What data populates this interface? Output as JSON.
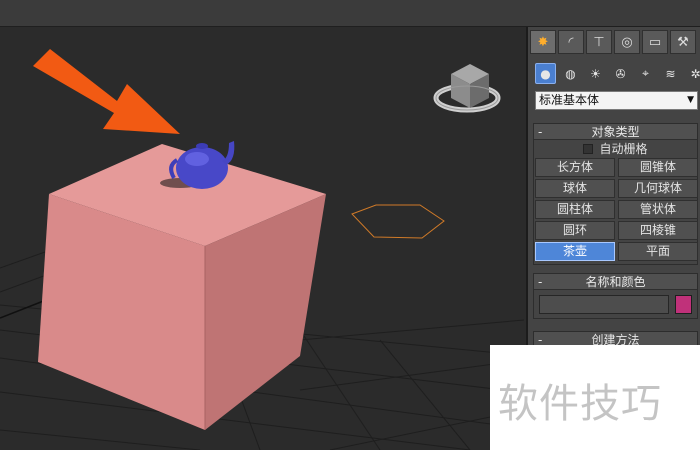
{
  "command_panel": {
    "tabs": [
      {
        "name": "create",
        "glyph": "✸"
      },
      {
        "name": "modify",
        "glyph": "◜"
      },
      {
        "name": "hierarchy",
        "glyph": "⊤"
      },
      {
        "name": "motion",
        "glyph": "◎"
      },
      {
        "name": "display",
        "glyph": "▭"
      },
      {
        "name": "utilities",
        "glyph": "⚒"
      }
    ],
    "category_icons": [
      {
        "name": "geometry",
        "glyph": "●"
      },
      {
        "name": "shapes",
        "glyph": "◍"
      },
      {
        "name": "lights",
        "glyph": "☀"
      },
      {
        "name": "cameras",
        "glyph": "✇"
      },
      {
        "name": "helpers",
        "glyph": "⌖"
      },
      {
        "name": "space-warps",
        "glyph": "≋"
      },
      {
        "name": "systems",
        "glyph": "✲"
      }
    ],
    "dropdown_value": "标准基本体",
    "object_type": {
      "title": "对象类型",
      "collapse": "-",
      "autogrid_label": "自动栅格",
      "buttons": [
        "长方体",
        "圆锥体",
        "球体",
        "几何球体",
        "圆柱体",
        "管状体",
        "圆环",
        "四棱锥",
        "茶壶",
        "平面"
      ],
      "active_button": "茶壶"
    },
    "name_color": {
      "title": "名称和颜色",
      "collapse": "-",
      "name_value": "",
      "color": "#c0317a"
    },
    "creation_method": {
      "title": "创建方法",
      "collapse": "-"
    }
  },
  "viewport": {
    "box_color": "#d9898a",
    "teapot_color": "#4a4acc",
    "arrow_color": "#f25a13",
    "hexagon_color": "#d07a28"
  },
  "watermark": {
    "text": "软件技巧"
  }
}
